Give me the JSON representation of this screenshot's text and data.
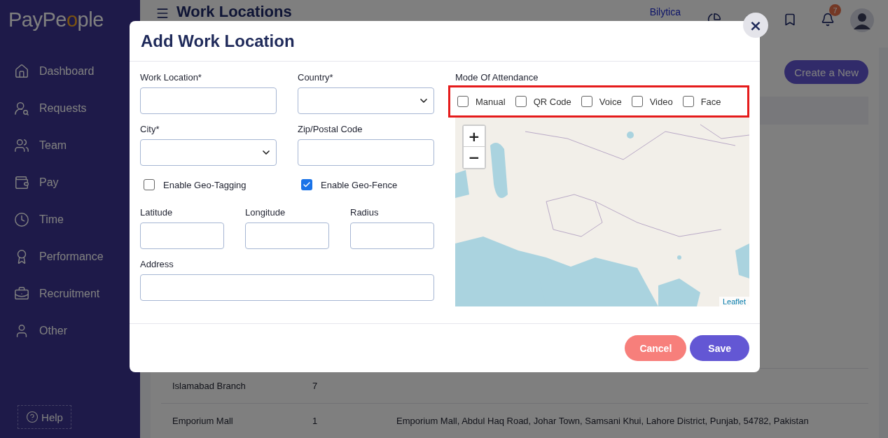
{
  "sidebar": {
    "logo": {
      "before": "PayPe",
      "accent": "o",
      "after": "ple"
    },
    "items": [
      {
        "label": "Dashboard"
      },
      {
        "label": "Requests"
      },
      {
        "label": "Team"
      },
      {
        "label": "Pay"
      },
      {
        "label": "Time"
      },
      {
        "label": "Performance"
      },
      {
        "label": "Recruitment"
      },
      {
        "label": "Other"
      }
    ],
    "help": "Help"
  },
  "header": {
    "title": "Work Locations",
    "company": "Bilytica",
    "notification_count": "7"
  },
  "page": {
    "create_button": "Create a New",
    "rows": [
      {
        "name": "Islamabad Branch",
        "count": "7"
      },
      {
        "name": "Emporium Mall",
        "count": "1",
        "address": "Emporium Mall, Abdul Haq Road, Johar Town, Samsani Khui, Lahore District, Punjab, 54782, Pakistan"
      }
    ]
  },
  "modal": {
    "title": "Add Work Location",
    "close": "×",
    "rows": [
      [
        {
          "kind": "text",
          "label": "Work Location*"
        },
        {
          "kind": "select",
          "label": "Country*"
        }
      ],
      [
        {
          "kind": "select",
          "label": "City*"
        },
        {
          "kind": "text",
          "label": "Zip/Postal Code"
        }
      ],
      [
        {
          "kind": "checkbox",
          "label": "Enable Geo-Tagging",
          "checked": false
        },
        {
          "kind": "checkbox",
          "label": "Enable Geo-Fence",
          "checked": true
        }
      ],
      [
        {
          "kind": "text",
          "label": "Latitude"
        },
        {
          "kind": "text",
          "label": "Longitude"
        },
        {
          "kind": "text",
          "label": "Radius"
        }
      ],
      [
        {
          "kind": "text",
          "label": "Address"
        }
      ]
    ],
    "attendance": {
      "label": "Mode Of Attendance",
      "highlighted": true,
      "modes": [
        {
          "label": "Manual",
          "checked": false
        },
        {
          "label": "QR Code",
          "checked": false
        },
        {
          "label": "Voice",
          "checked": false
        },
        {
          "label": "Video",
          "checked": false
        },
        {
          "label": "Face",
          "checked": false
        }
      ]
    },
    "map": {
      "zoom_in": "+",
      "zoom_out": "−",
      "attribution": "Leaflet"
    },
    "buttons": [
      {
        "kind": "cancel",
        "label": "Cancel"
      },
      {
        "kind": "save",
        "label": "Save"
      }
    ]
  }
}
